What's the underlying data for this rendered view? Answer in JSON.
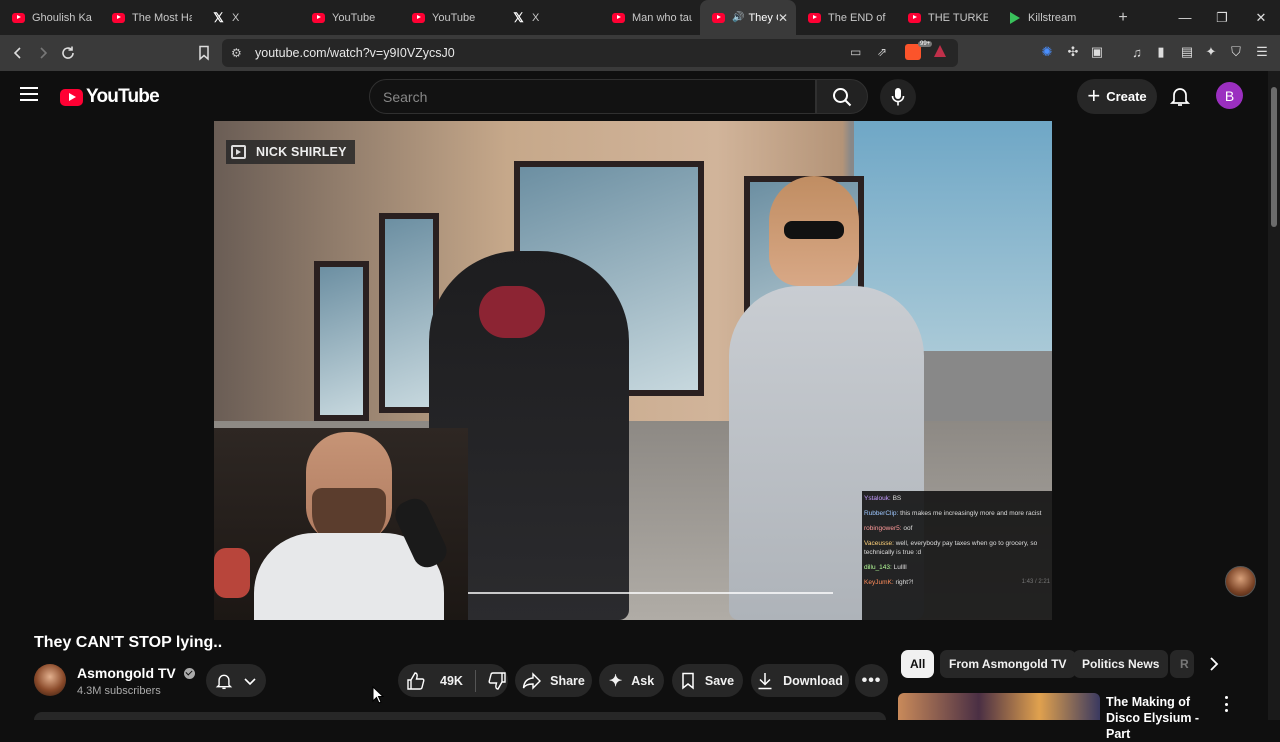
{
  "browser": {
    "tabs": [
      {
        "label": "Ghoulish Kar",
        "icon": "youtube"
      },
      {
        "label": "The Most Ha",
        "icon": "youtube"
      },
      {
        "label": "X",
        "icon": "x"
      },
      {
        "label": "YouTube",
        "icon": "youtube"
      },
      {
        "label": "YouTube",
        "icon": "youtube"
      },
      {
        "label": "X",
        "icon": "x"
      },
      {
        "label": "Man who tau",
        "icon": "youtube"
      },
      {
        "label": "They C",
        "icon": "youtube",
        "active": true
      },
      {
        "label": "The END of L",
        "icon": "youtube"
      },
      {
        "label": "THE TURKEY",
        "icon": "youtube"
      },
      {
        "label": "Killstream",
        "icon": "killstream"
      }
    ],
    "url": "youtube.com/watch?v=y9I0VZycsJ0",
    "brave_badge": "99+"
  },
  "header": {
    "logo_text": "YouTube",
    "search_placeholder": "Search",
    "create_label": "Create",
    "avatar_letter": "B"
  },
  "video": {
    "watermark": "NICK SHIRLEY",
    "chat": [
      {
        "user": "Ystalouk:",
        "msg": "BS"
      },
      {
        "user": "RubberClip:",
        "msg": "this makes me increasingly more and more racist"
      },
      {
        "user": "robingower5:",
        "msg": "oof"
      },
      {
        "user": "Vaceusse:",
        "msg": "well, everybody pay taxes when go to grocery, so technically is true :d"
      },
      {
        "user": "dillu_143:",
        "msg": "Lullll"
      },
      {
        "user": "KeyJumK:",
        "msg": "right?!"
      }
    ],
    "timestamp": "1:43 / 2:21"
  },
  "watch": {
    "title": "They CAN'T STOP lying..",
    "channel_name": "Asmongold TV",
    "subscribers": "4.3M subscribers",
    "likes": "49K",
    "share_label": "Share",
    "ask_label": "Ask",
    "save_label": "Save",
    "download_label": "Download"
  },
  "sidebar": {
    "chips": [
      "All",
      "From Asmongold TV",
      "Politics News",
      "R"
    ],
    "rec_title": "The Making of Disco Elysium - Part"
  },
  "colors": {
    "yt_red": "#ff0033",
    "avatar_purple": "#9b2fc0",
    "background": "#0f0f0f"
  }
}
